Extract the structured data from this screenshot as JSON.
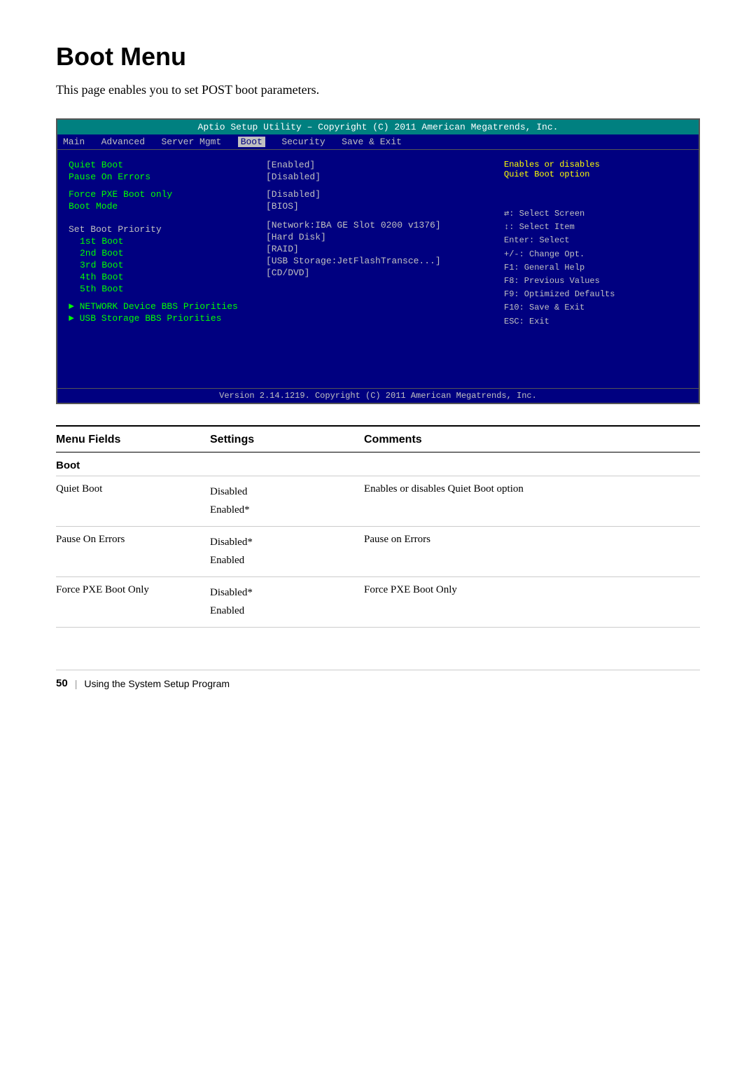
{
  "page": {
    "title": "Boot Menu",
    "subtitle": "This page enables you to set POST boot parameters."
  },
  "bios": {
    "title_bar": "Aptio Setup Utility – Copyright (C) 2011 American Megatrends, Inc.",
    "menu_bar": {
      "items": [
        "Main",
        "Advanced",
        "Server Mgmt",
        "Boot",
        "Security",
        "Save & Exit"
      ],
      "active": "Boot"
    },
    "left_items": [
      {
        "label": "Quiet Boot",
        "indent": false,
        "arrow": false,
        "section": false
      },
      {
        "label": "Pause On Errors",
        "indent": false,
        "arrow": false,
        "section": false
      },
      {
        "label": "",
        "indent": false,
        "arrow": false,
        "section": false
      },
      {
        "label": "Force PXE Boot only",
        "indent": false,
        "arrow": false,
        "section": false
      },
      {
        "label": "Boot Mode",
        "indent": false,
        "arrow": false,
        "section": false
      },
      {
        "label": "",
        "indent": false,
        "arrow": false,
        "section": false
      },
      {
        "label": "Set Boot Priority",
        "indent": false,
        "arrow": false,
        "section": true
      },
      {
        "label": "1st Boot",
        "indent": true,
        "arrow": false,
        "section": false
      },
      {
        "label": "2nd Boot",
        "indent": true,
        "arrow": false,
        "section": false
      },
      {
        "label": "3rd Boot",
        "indent": true,
        "arrow": false,
        "section": false
      },
      {
        "label": "4th Boot",
        "indent": true,
        "arrow": false,
        "section": false
      },
      {
        "label": "5th Boot",
        "indent": true,
        "arrow": false,
        "section": false
      },
      {
        "label": "",
        "indent": false,
        "arrow": false,
        "section": false
      },
      {
        "label": "▶ NETWORK Device BBS Priorities",
        "indent": false,
        "arrow": true,
        "section": false
      },
      {
        "label": "▶ USB Storage BBS Priorities",
        "indent": false,
        "arrow": true,
        "section": false
      }
    ],
    "middle_items": [
      {
        "val": "[Enabled]"
      },
      {
        "val": "[Disabled]"
      },
      {
        "val": ""
      },
      {
        "val": "[Disabled]"
      },
      {
        "val": "[BIOS]"
      },
      {
        "val": ""
      },
      {
        "val": ""
      },
      {
        "val": "[Network:IBA GE Slot 0200 v1376]"
      },
      {
        "val": "[Hard Disk]"
      },
      {
        "val": "[RAID]"
      },
      {
        "val": "[USB Storage:JetFlashTransce...]"
      },
      {
        "val": "[CD/DVD]"
      }
    ],
    "right_help": "Enables or disables\nQuiet Boot option",
    "key_help": [
      "↔: Select Screen",
      "↑↓: Select Item",
      "Enter: Select",
      "+/-: Change Opt.",
      "F1: General Help",
      "F8: Previous Values",
      "F9: Optimized Defaults",
      "F10: Save & Exit",
      "ESC: Exit"
    ],
    "footer": "Version 2.14.1219. Copyright (C) 2011 American Megatrends, Inc."
  },
  "table": {
    "headers": [
      "Menu Fields",
      "Settings",
      "Comments"
    ],
    "section_label": "Boot",
    "rows": [
      {
        "field": "Quiet Boot",
        "settings": [
          "Disabled",
          "Enabled*"
        ],
        "comment": "Enables or disables Quiet Boot option"
      },
      {
        "field": "Pause On Errors",
        "settings": [
          "Disabled*",
          "Enabled"
        ],
        "comment": "Pause on Errors"
      },
      {
        "field": "Force PXE Boot Only",
        "settings": [
          "Disabled*",
          "Enabled"
        ],
        "comment": "Force PXE Boot Only"
      }
    ]
  },
  "footer": {
    "page_number": "50",
    "separator": "|",
    "text": "Using the System Setup Program"
  }
}
